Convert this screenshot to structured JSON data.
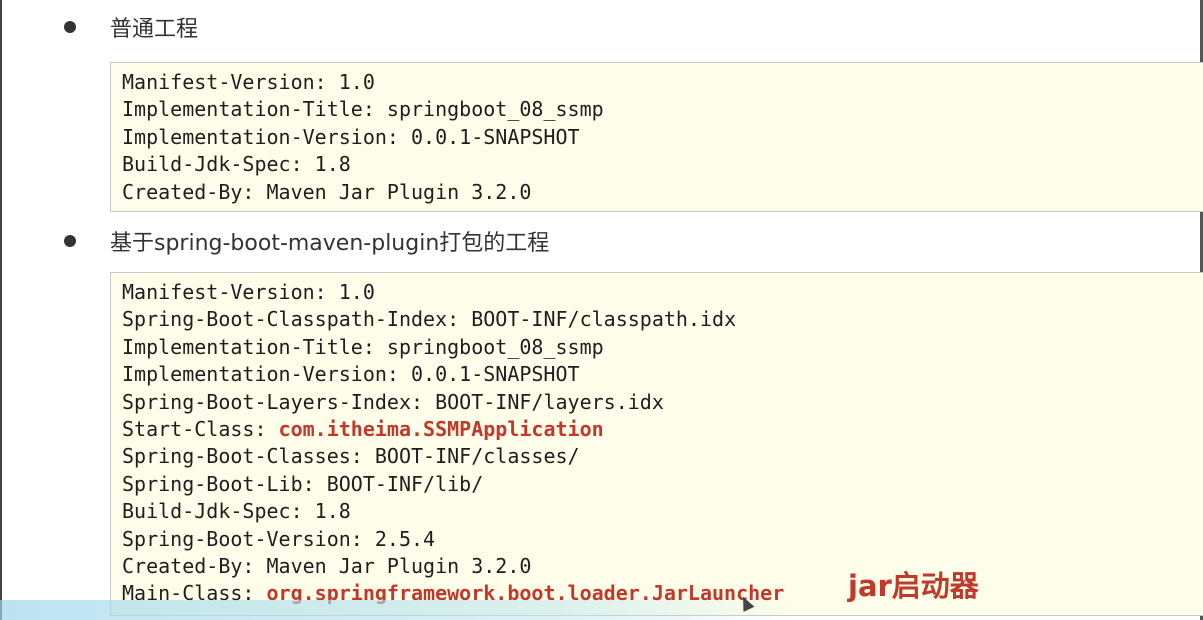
{
  "section1": {
    "heading": "普通工程",
    "lines": [
      {
        "key": "Manifest-Version: ",
        "value": "1.0"
      },
      {
        "key": "Implementation-Title: ",
        "value": "springboot_08_ssmp"
      },
      {
        "key": "Implementation-Version: ",
        "value": "0.0.1-SNAPSHOT"
      },
      {
        "key": "Build-Jdk-Spec: ",
        "value": "1.8"
      },
      {
        "key": "Created-By: ",
        "value": "Maven Jar Plugin 3.2.0"
      }
    ]
  },
  "section2": {
    "heading": "基于spring-boot-maven-plugin打包的工程",
    "lines": [
      {
        "key": "Manifest-Version: ",
        "value": "1.0"
      },
      {
        "key": "Spring-Boot-Classpath-Index: ",
        "value": "BOOT-INF/classpath.idx"
      },
      {
        "key": "Implementation-Title: ",
        "value": "springboot_08_ssmp"
      },
      {
        "key": "Implementation-Version: ",
        "value": "0.0.1-SNAPSHOT"
      },
      {
        "key": "Spring-Boot-Layers-Index: ",
        "value": "BOOT-INF/layers.idx"
      },
      {
        "key": "Start-Class: ",
        "value": "com.itheima.SSMPApplication"
      },
      {
        "key": "Spring-Boot-Classes: ",
        "value": "BOOT-INF/classes/"
      },
      {
        "key": "Spring-Boot-Lib: ",
        "value": "BOOT-INF/lib/"
      },
      {
        "key": "Build-Jdk-Spec: ",
        "value": "1.8"
      },
      {
        "key": "Spring-Boot-Version: ",
        "value": "2.5.4"
      },
      {
        "key": "Created-By: ",
        "value": "Maven Jar Plugin 3.2.0"
      },
      {
        "key": "Main-Class: ",
        "value": "org.springframework.boot.loader.JarLauncher"
      }
    ],
    "annotation": "jar启动器"
  },
  "colors": {
    "highlight": "#c0392b",
    "code_background": "#fefdea",
    "text": "#1e1e1e"
  }
}
